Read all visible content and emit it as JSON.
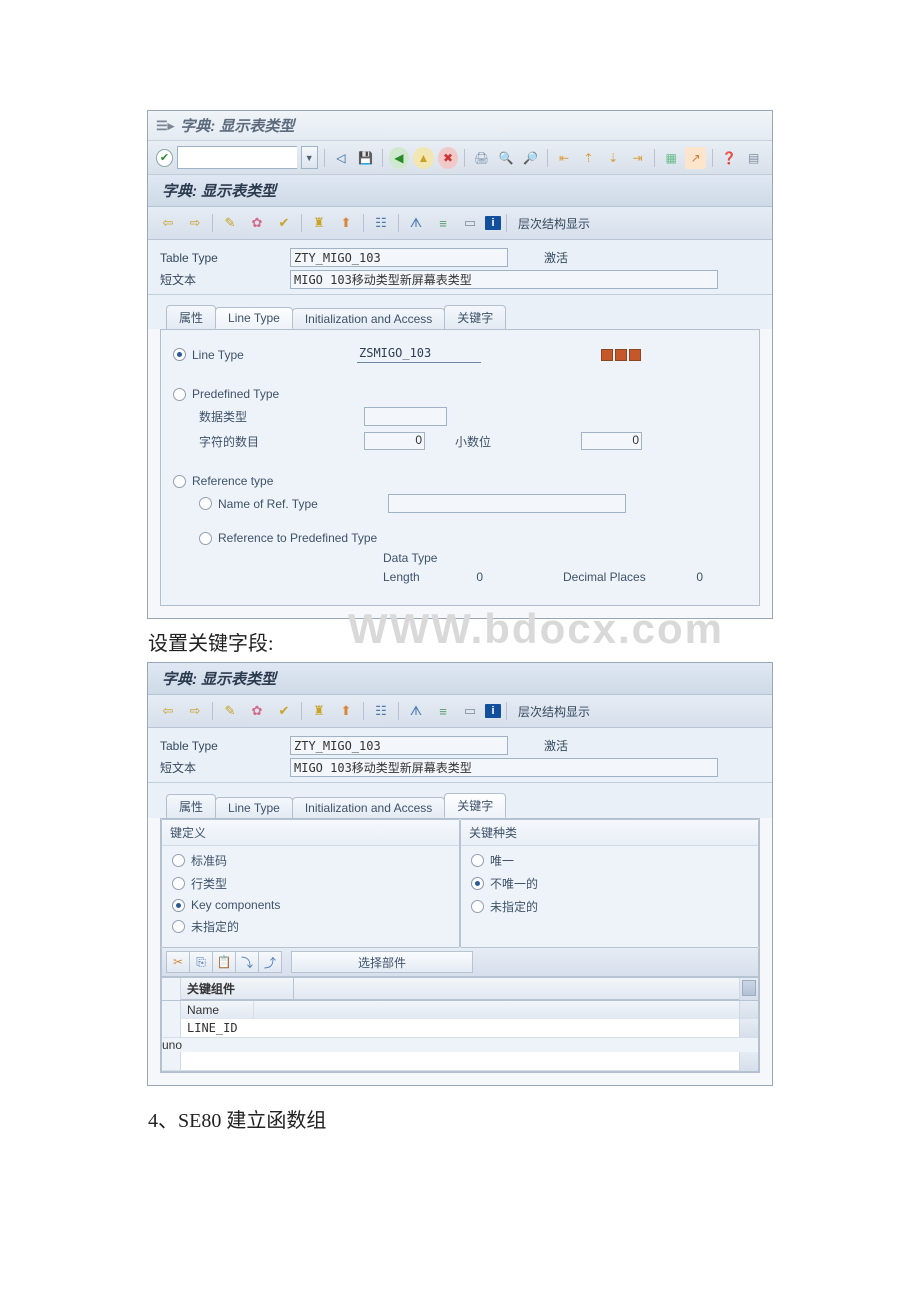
{
  "watermark": "WWW.bdocx.com",
  "window1": {
    "title": "字典: 显示表类型",
    "subtitle": "字典: 显示表类型",
    "app_toolbar_suffix": "层次结构显示",
    "form": {
      "table_type_label": "Table Type",
      "table_type_value": "ZTY_MIGO_103",
      "status": "激活",
      "short_text_label": "短文本",
      "short_text_value": "MIGO 103移动类型新屏幕表类型"
    },
    "tabs": {
      "t1": "属性",
      "t2": "Line Type",
      "t3": "Initialization and Access",
      "t4": "关键字"
    },
    "line_type": {
      "opt1": "Line Type",
      "opt1_value": "ZSMIGO_103",
      "opt2": "Predefined Type",
      "data_type_label": "数据类型",
      "char_count_label": "字符的数目",
      "char_count_value": "0",
      "decimals_label": "小数位",
      "decimals_value": "0",
      "opt3": "Reference type",
      "opt3a": "Name of Ref. Type",
      "opt4": "Reference to Predefined Type",
      "data_type2": "Data Type",
      "length_label": "Length",
      "length_value": "0",
      "dec_places_label": "Decimal Places",
      "dec_places_value": "0"
    }
  },
  "interlude": "设置关键字段:",
  "window2": {
    "subtitle": "字典: 显示表类型",
    "app_toolbar_suffix": "层次结构显示",
    "form": {
      "table_type_label": "Table Type",
      "table_type_value": "ZTY_MIGO_103",
      "status": "激活",
      "short_text_label": "短文本",
      "short_text_value": "MIGO 103移动类型新屏幕表类型"
    },
    "tabs": {
      "t1": "属性",
      "t2": "Line Type",
      "t3": "Initialization and Access",
      "t4": "关键字"
    },
    "key_def": {
      "title": "键定义",
      "o1": "标准码",
      "o2": "行类型",
      "o3": "Key components",
      "o4": "未指定的"
    },
    "key_kind": {
      "title": "关键种类",
      "o1": "唯一",
      "o2": "不唯一的",
      "o3": "未指定的"
    },
    "select_btn": "选择部件",
    "grid": {
      "group_title": "关键组件",
      "col_name": "Name",
      "row1": "LINE_ID"
    }
  },
  "post_text": "4、SE80 建立函数组"
}
